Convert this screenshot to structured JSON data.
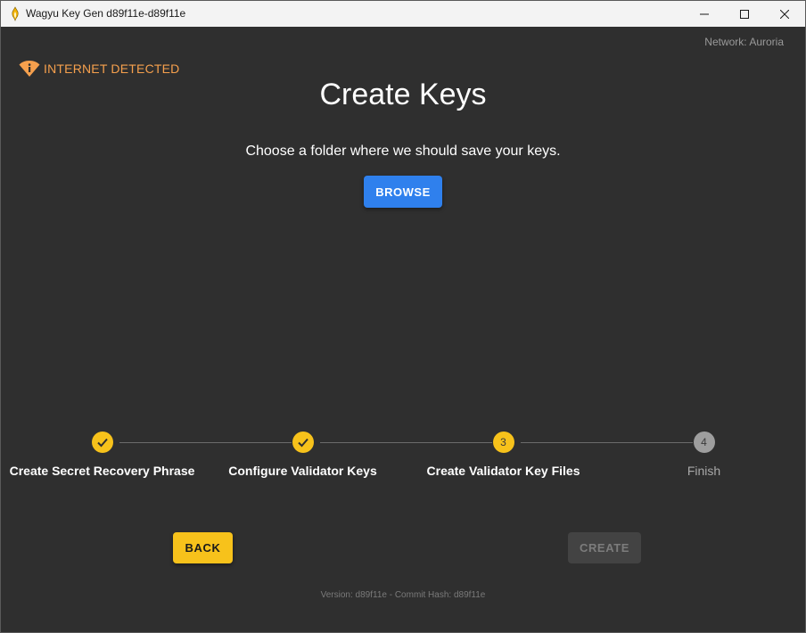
{
  "window": {
    "title": "Wagyu Key Gen d89f11e-d89f11e"
  },
  "header": {
    "network": "Network: Auroria",
    "internet_warning": "INTERNET DETECTED"
  },
  "main": {
    "title": "Create Keys",
    "subtitle": "Choose a folder where we should save your keys.",
    "browse_label": "BROWSE"
  },
  "stepper": {
    "steps": [
      {
        "label": "Create Secret Recovery Phrase",
        "status": "done",
        "number": "1"
      },
      {
        "label": "Configure Validator Keys",
        "status": "done",
        "number": "2"
      },
      {
        "label": "Create Validator Key Files",
        "status": "active",
        "number": "3"
      },
      {
        "label": "Finish",
        "status": "pending",
        "number": "4"
      }
    ]
  },
  "footer": {
    "back_label": "BACK",
    "create_label": "CREATE",
    "version": "Version: d89f11e - Commit Hash: d89f11e"
  },
  "colors": {
    "accent_yellow": "#f7c21b",
    "primary_blue": "#2f80ed",
    "warning_orange": "#f6a04d",
    "background": "#2f2f2f"
  },
  "icons": {
    "app": "flame-icon",
    "warning": "wifi-warning-icon",
    "check": "check-icon"
  }
}
